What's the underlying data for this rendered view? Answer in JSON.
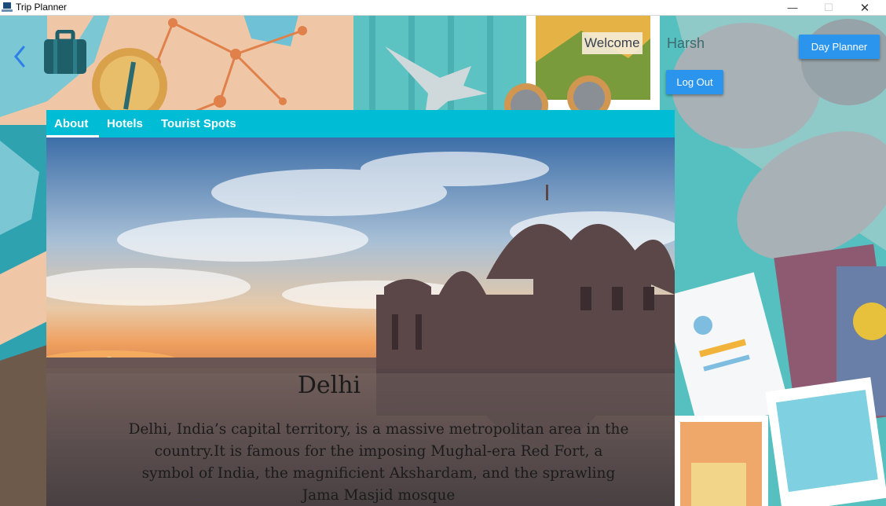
{
  "window": {
    "title": "Trip Planner",
    "controls": {
      "minimize": "—",
      "maximize": "☐",
      "close": "✕"
    }
  },
  "header": {
    "welcome_label": "Welcome",
    "username": "Harsh",
    "day_planner_label": "Day Planner",
    "logout_label": "Log Out"
  },
  "tabs": [
    {
      "label": "About",
      "selected": true
    },
    {
      "label": "Hotels",
      "selected": false
    },
    {
      "label": "Tourist Spots",
      "selected": false
    }
  ],
  "city": {
    "name": "Delhi",
    "description": "Delhi, India’s capital territory, is a massive metropolitan area in the country.It is famous for the imposing Mughal-era Red Fort, a symbol of India, the magnificient Akshardam, and the sprawling Jama Masjid mosque"
  },
  "icons": {
    "back": "back-arrow-icon",
    "logo": "suitcase-icon"
  },
  "colors": {
    "tab_bar": "#00bdd5",
    "button": "#2b95ee",
    "background": "#3fb6b8"
  }
}
